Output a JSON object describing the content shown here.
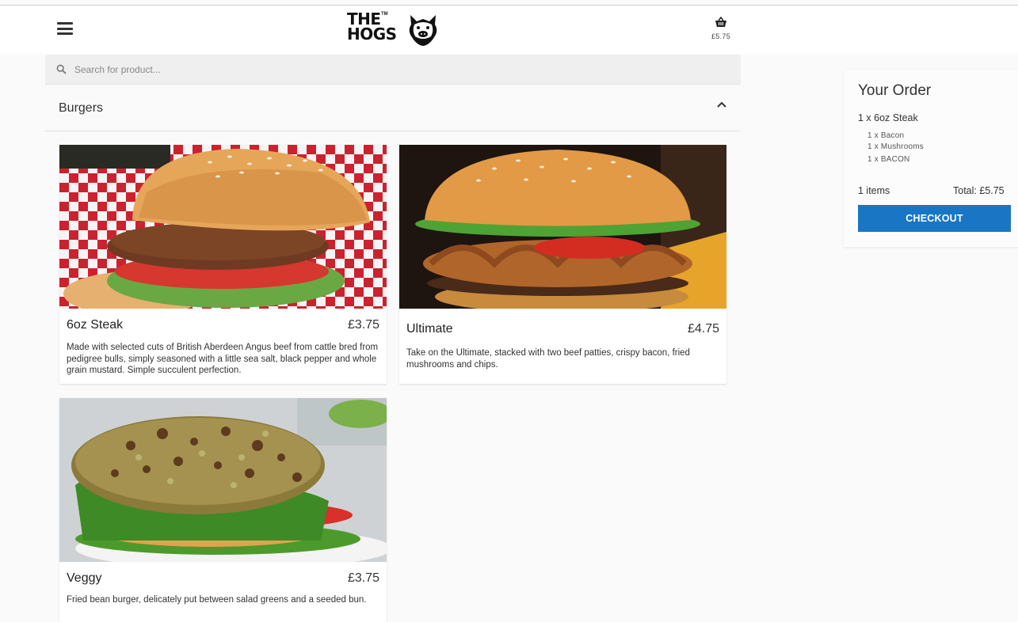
{
  "header": {
    "logo_line1": "THE",
    "logo_tm": "TM",
    "logo_line2": "HOGS",
    "basket_total": "£5.75"
  },
  "search": {
    "placeholder": "Search for product..."
  },
  "category": {
    "title": "Burgers",
    "expanded": true
  },
  "products": [
    {
      "name": "6oz Steak",
      "price": "£3.75",
      "description": "Made with selected cuts of British Aberdeen Angus beef from cattle bred from pedigree bulls, simply seasoned with a little sea salt, black pepper and whole grain mustard. Simple succulent perfection."
    },
    {
      "name": "Ultimate",
      "price": "£4.75",
      "description": "Take on the Ultimate, stacked with two beef patties, crispy bacon, fried mushrooms and chips."
    },
    {
      "name": "Veggy",
      "price": "£3.75",
      "description": "Fried bean burger, delicately put between salad greens and a seeded bun."
    }
  ],
  "order": {
    "title": "Your Order",
    "line": "1 x  6oz Steak",
    "extras": [
      "1 x Bacon",
      "1 x Mushrooms",
      "1 x BACON"
    ],
    "items_count": "1 items",
    "total": "Total: £5.75",
    "checkout_label": "CHECKOUT"
  },
  "colors": {
    "accent": "#1976c4",
    "background": "#fafafa"
  }
}
